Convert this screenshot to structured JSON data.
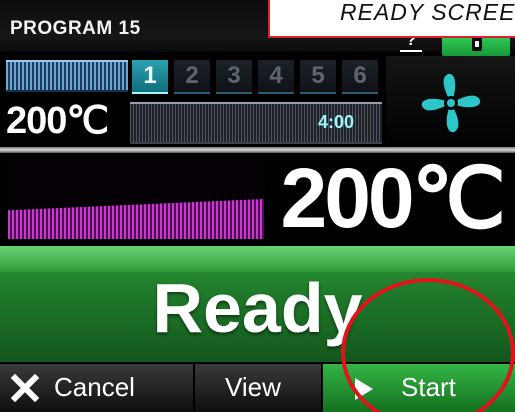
{
  "header": {
    "program_title": "PROGRAM 15",
    "help_icon_glyph": "?",
    "lock_icon": "key-lock-icon"
  },
  "annotation": {
    "caption": "READY SCREEN",
    "ring_color": "#e0141a"
  },
  "stages": {
    "items": [
      "1",
      "2",
      "3",
      "4",
      "5",
      "6"
    ],
    "active_index": 0
  },
  "set_point": {
    "temperature": "200℃",
    "time": "4:00"
  },
  "fan": {
    "icon": "fan-icon",
    "color": "#2cc7c9"
  },
  "actual": {
    "temperature": "200℃",
    "heat_level_fraction": 0.5,
    "bar_color": "#c93ad0"
  },
  "status": {
    "label": "Ready",
    "color": "#1f7a2a"
  },
  "buttons": {
    "cancel_label": "Cancel",
    "view_label": "View",
    "start_label": "Start"
  }
}
